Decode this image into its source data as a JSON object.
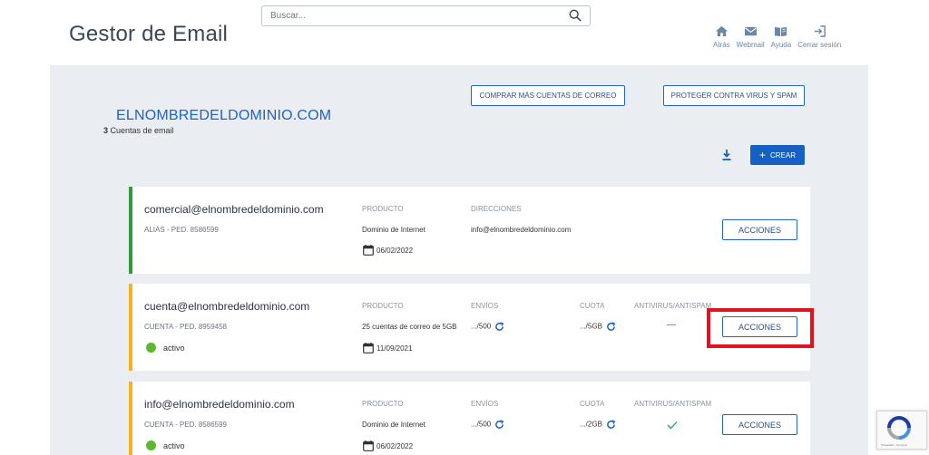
{
  "header": {
    "app_title": "Gestor de Email",
    "search_placeholder": "Buscar...",
    "nav": [
      {
        "label": "Atrás",
        "icon": "home-icon"
      },
      {
        "label": "Webmail",
        "icon": "mail-icon"
      },
      {
        "label": "Ayuda",
        "icon": "book-icon"
      },
      {
        "label": "Cerrar sesión",
        "icon": "logout-icon"
      }
    ]
  },
  "domain": {
    "name": "ELNOMBREDELDOMINIO.COM",
    "count": "3",
    "count_label": " Cuentas de email",
    "buy_button": "COMPRAR MÁS CUENTAS DE CORREO",
    "protect_button": "PROTEGER CONTRA VIRUS Y SPAM",
    "create_button": "CREAR"
  },
  "labels": {
    "product": "PRODUCTO",
    "addresses": "DIRECCIONES",
    "sends": "ENVÍOS",
    "quota": "CUOTA",
    "antivirus": "ANTIVIRUS/ANTISPAM",
    "actions": "ACCIONES"
  },
  "accounts": [
    {
      "email": "comercial@elnombredeldominio.com",
      "sub": "ALIAS - PED. 8586599",
      "product": "Dominio de Internet",
      "address": "info@elnombredeldominio.com",
      "date": "06/02/2022",
      "bar_color": "#2e9a3a"
    },
    {
      "email": "cuenta@elnombredeldominio.com",
      "sub": "CUENTA - PED. 8959458",
      "product": "25 cuentas de correo de 5GB",
      "sends": ".../500",
      "quota": ".../5GB",
      "antivirus": "—",
      "status": "activo",
      "date": "11/09/2021",
      "bar_color": "#f5b21b"
    },
    {
      "email": "info@elnombredeldominio.com",
      "sub": "CUENTA - PED. 8586599",
      "product": "Dominio de Internet",
      "sends": ".../500",
      "quota": ".../2GB",
      "status": "activo",
      "date": "06/02/2022",
      "bar_color": "#f5b21b"
    }
  ],
  "recaptcha": {
    "text": "Privacidad - Términos"
  }
}
